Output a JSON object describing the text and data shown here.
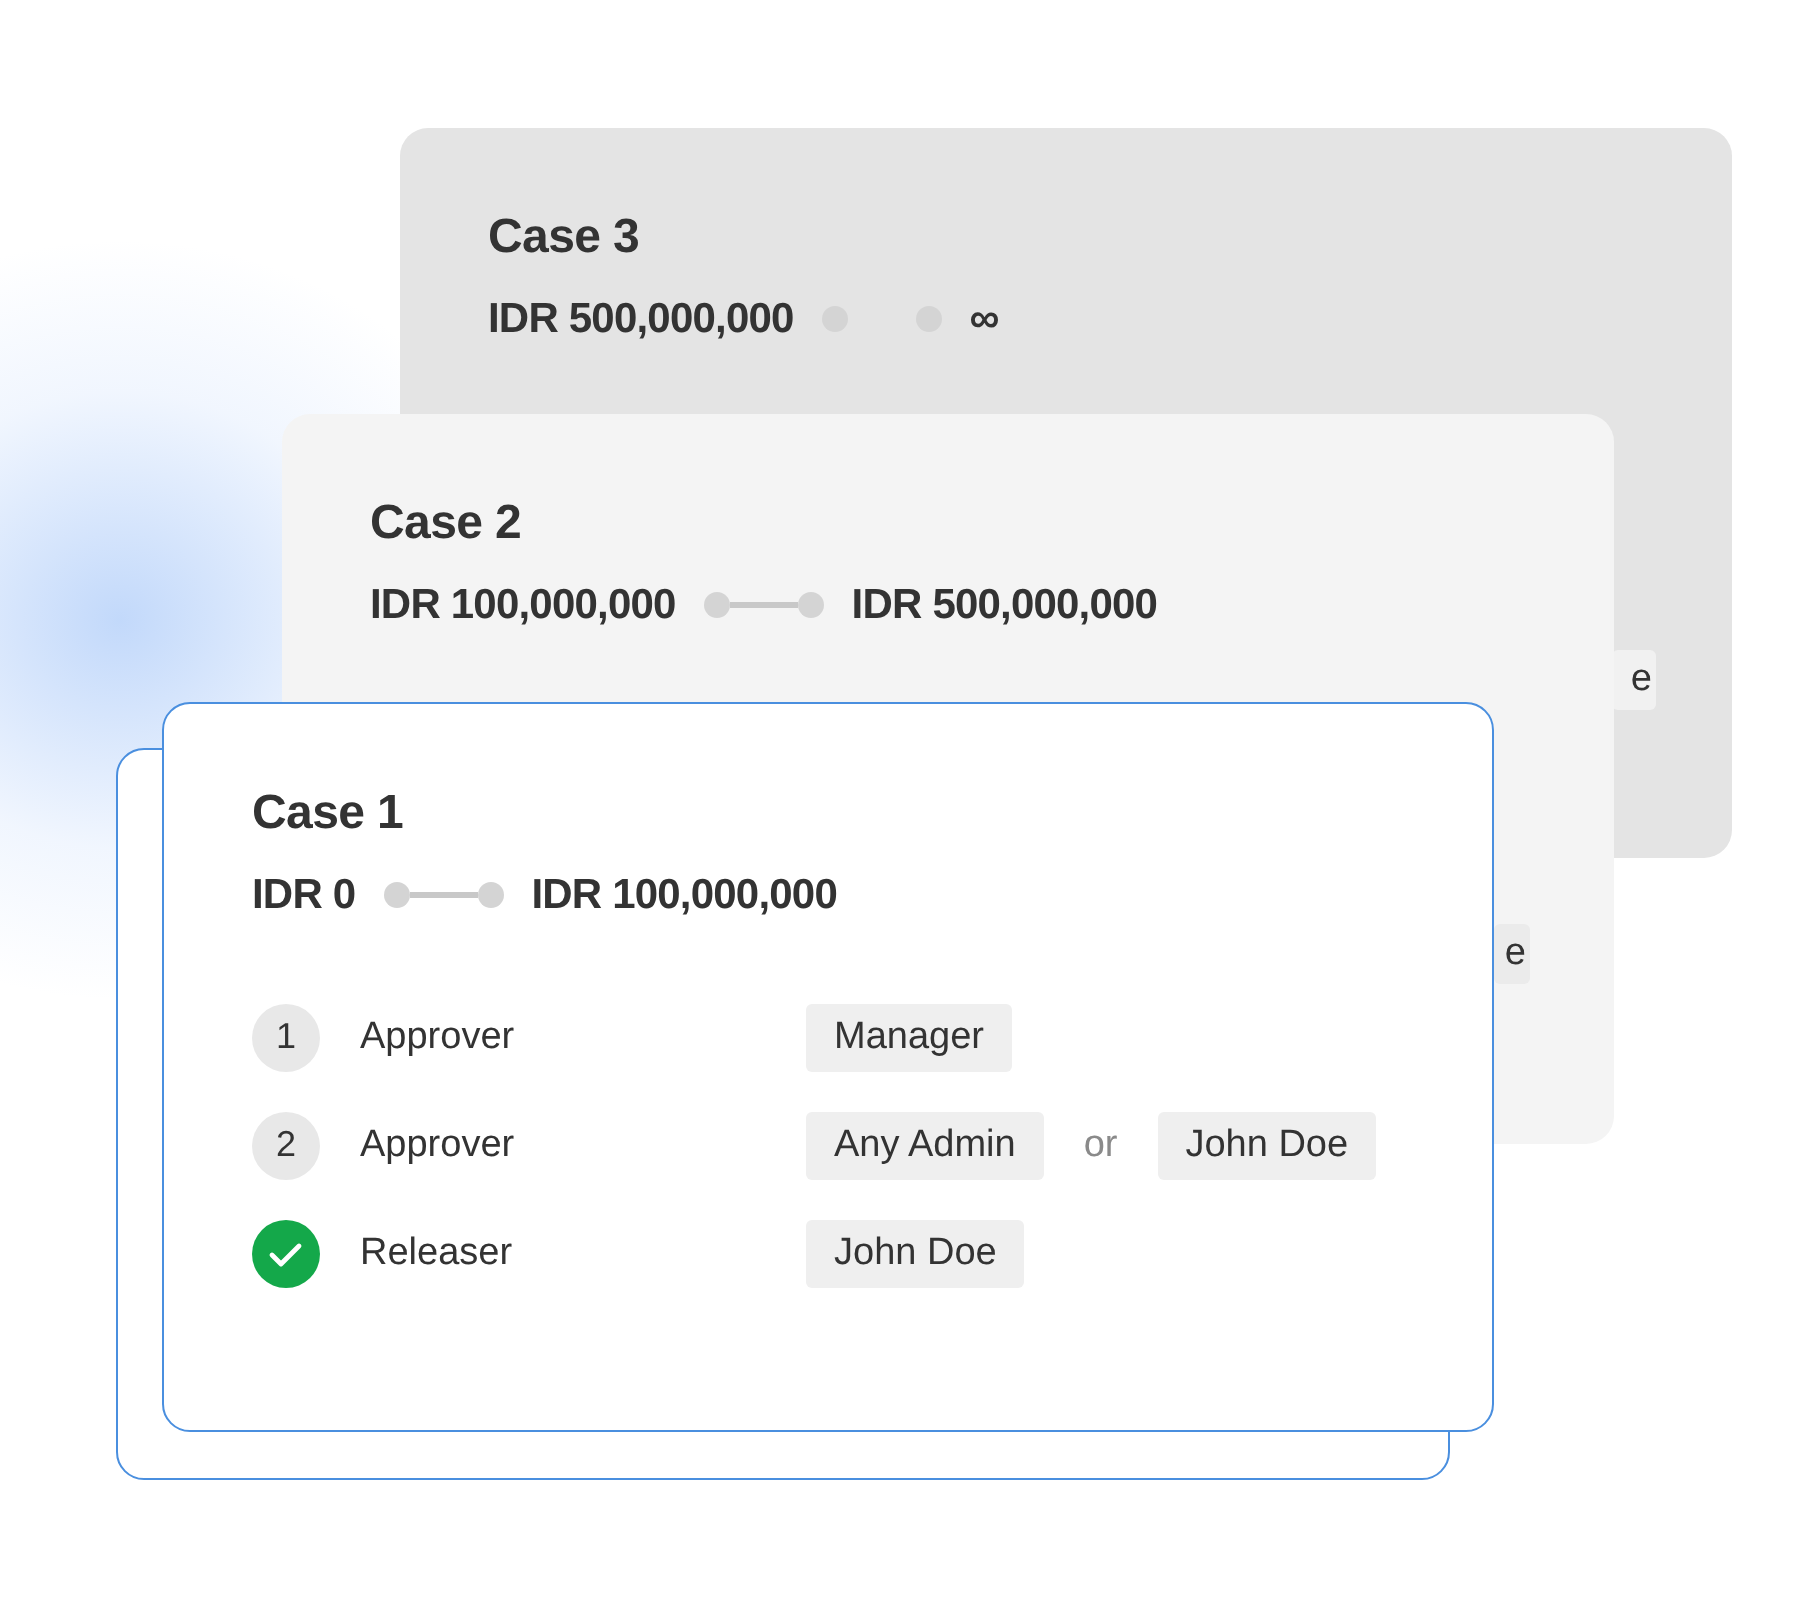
{
  "cases": [
    {
      "title": "Case 3",
      "from": "IDR 500,000,000",
      "to": "∞",
      "connector_line": false,
      "selected": false,
      "peek_tag": "e"
    },
    {
      "title": "Case 2",
      "from": "IDR 100,000,000",
      "to": "IDR 500,000,000",
      "connector_line": true,
      "selected": false,
      "peek_tag": "e"
    },
    {
      "title": "Case 1",
      "from": "IDR 0",
      "to": "IDR 100,000,000",
      "connector_line": true,
      "selected": true,
      "steps": [
        {
          "kind": "number",
          "marker": "1",
          "label": "Approver",
          "assignees": [
            {
              "kind": "tag",
              "text": "Manager"
            }
          ]
        },
        {
          "kind": "number",
          "marker": "2",
          "label": "Approver",
          "assignees": [
            {
              "kind": "tag",
              "text": "Any Admin"
            },
            {
              "kind": "word",
              "text": "or"
            },
            {
              "kind": "tag",
              "text": "John Doe"
            }
          ]
        },
        {
          "kind": "done",
          "label": "Releaser",
          "assignees": [
            {
              "kind": "tag",
              "text": "John Doe"
            }
          ]
        }
      ]
    }
  ]
}
